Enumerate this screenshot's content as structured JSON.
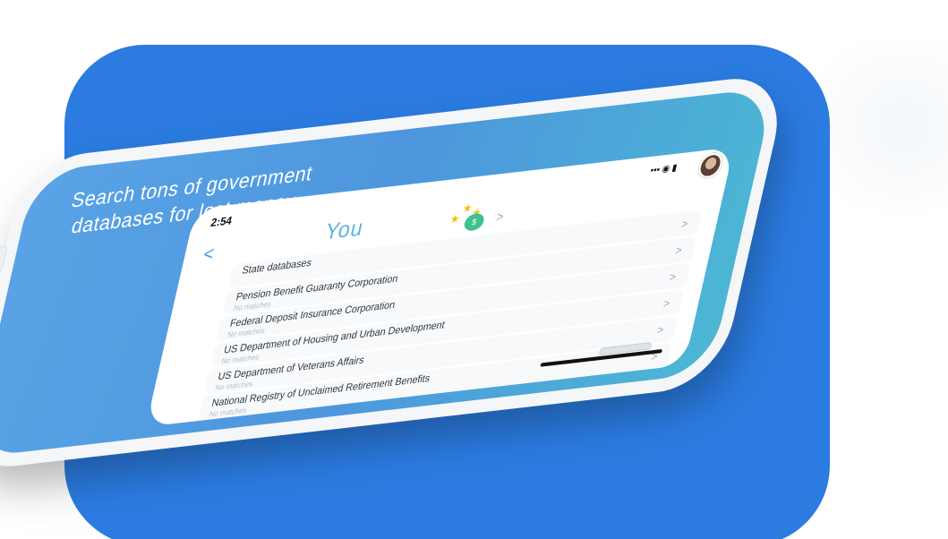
{
  "marketing": {
    "headline": "Search tons of government databases for lost money."
  },
  "app": {
    "status_time": "2:54",
    "status_icons": "▪▪▪ ◉ ▮",
    "back_symbol": "<",
    "title": "You",
    "reward_badge_text": "$"
  },
  "list": {
    "items": [
      {
        "title": "State databases",
        "subtitle": "",
        "chevron": ">"
      },
      {
        "title": "Pension Benefit Guaranty Corporation",
        "subtitle": "No matches",
        "chevron": ">"
      },
      {
        "title": "Federal Deposit Insurance Corporation",
        "subtitle": "No matches",
        "chevron": ">"
      },
      {
        "title": "US Department of Housing and Urban Development",
        "subtitle": "No matches",
        "chevron": ">"
      },
      {
        "title": "US Department of Veterans Affairs",
        "subtitle": "No matches",
        "chevron": ">"
      },
      {
        "title": "National Registry of Unclaimed Retirement Benefits",
        "subtitle": "No matches",
        "chevron": ">"
      }
    ]
  },
  "colors": {
    "background_blue": "#2b7be0",
    "screen_gradient_start": "#5aa3e6",
    "screen_gradient_end": "#4cb7d4",
    "title_color": "#5cb6d8",
    "reward_green": "#3cc28d",
    "star_yellow": "#f2c10c"
  }
}
